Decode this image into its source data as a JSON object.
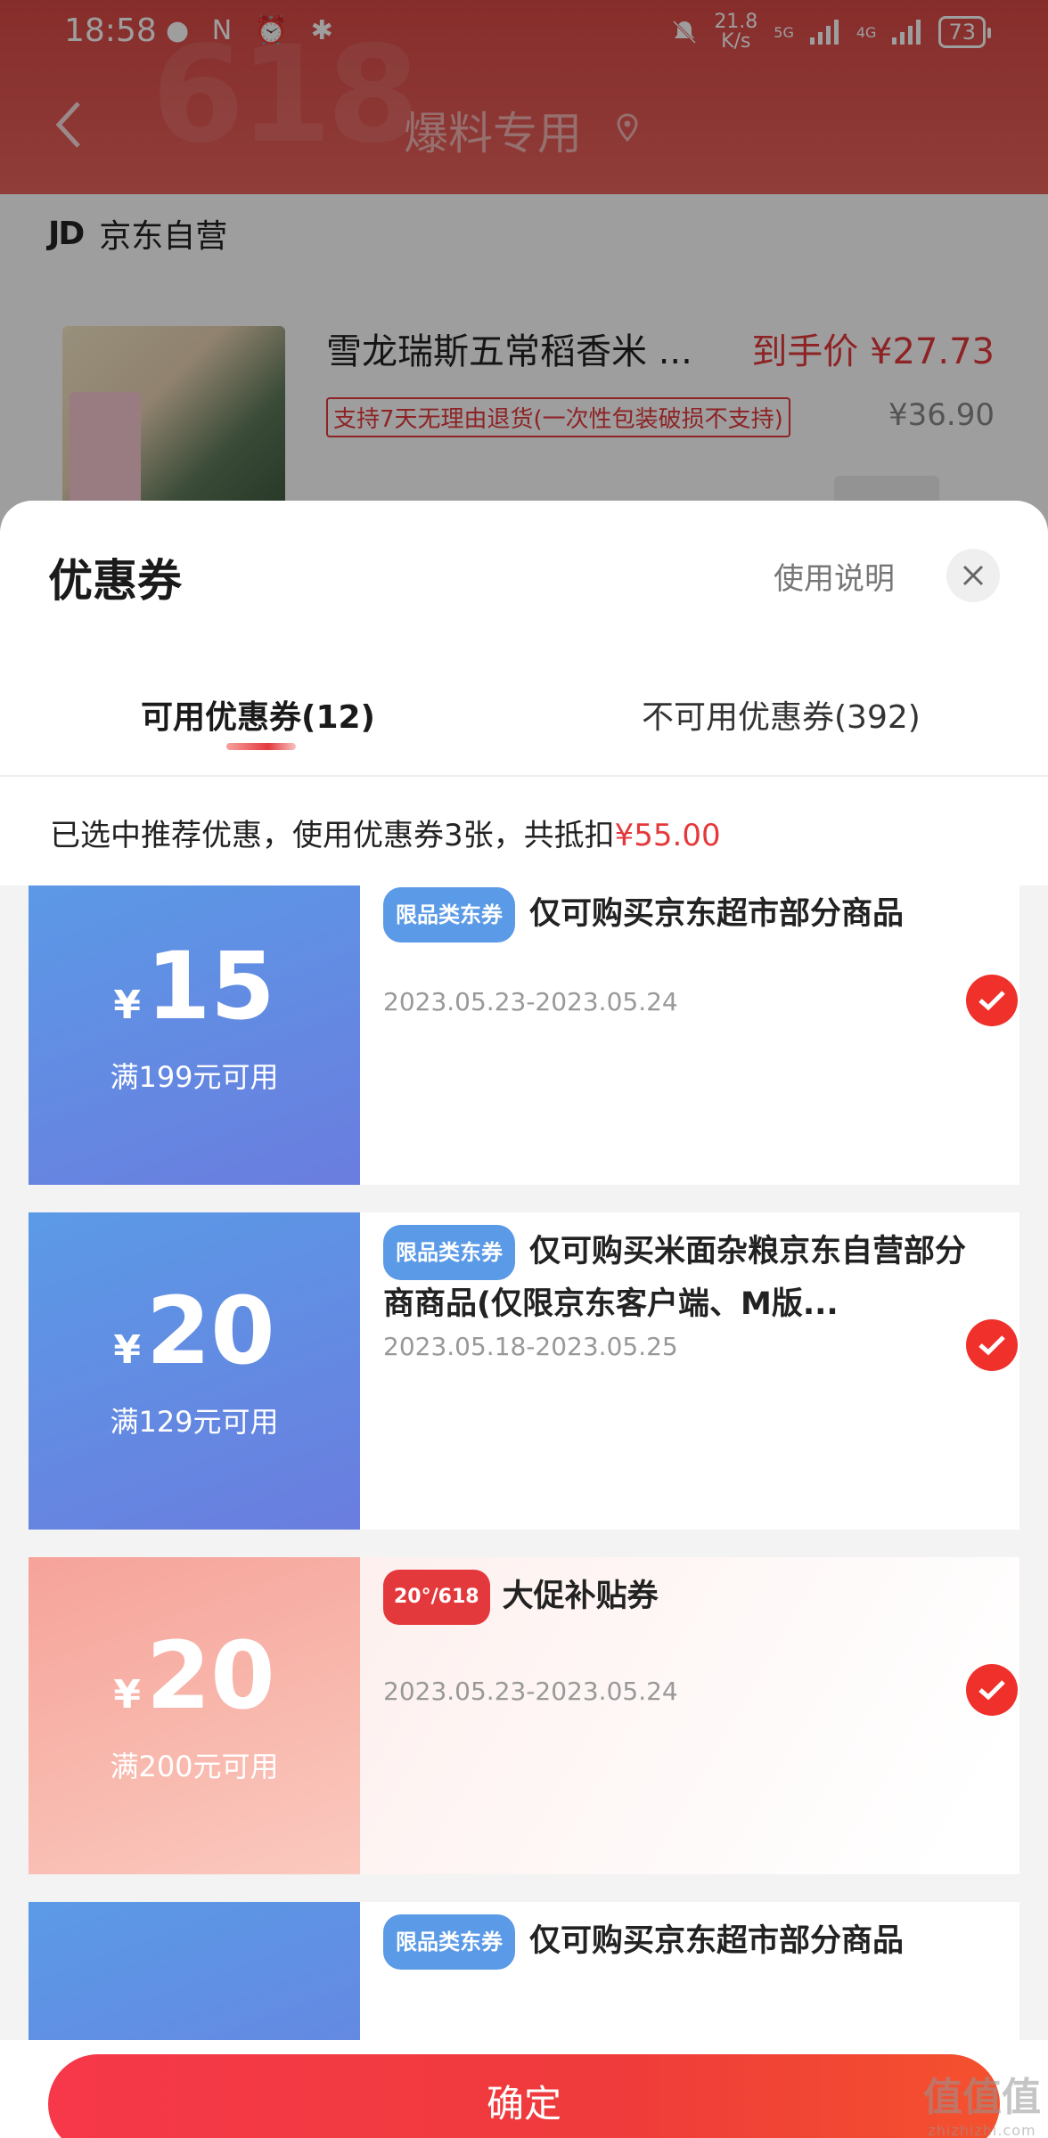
{
  "status_bar": {
    "time": "18:58",
    "left_icons": "● N ⏰ ✱",
    "net_speed_value": "21.8",
    "net_speed_unit": "K/s",
    "signal_5g": "5G",
    "signal_4g": "4G",
    "battery": "73"
  },
  "nav": {
    "title": "爆料专用"
  },
  "store": {
    "logo": "JD",
    "name": "京东自营"
  },
  "product": {
    "name": "雪龙瑞斯五常稻香米 ...",
    "final_price": "到手价 ¥27.73",
    "return_policy": "支持7天无理由退货(一次性包装破损不支持)",
    "original_price": "¥36.90"
  },
  "sheet": {
    "title": "优惠券",
    "help_label": "使用说明",
    "tabs": [
      {
        "label": "可用优惠券(12)",
        "active": true
      },
      {
        "label": "不可用优惠券(392)",
        "active": false
      }
    ],
    "summary_prefix": "已选中推荐优惠，使用优惠券3张，共抵扣",
    "summary_amount": "¥55.00"
  },
  "coupons": [
    {
      "currency": "¥",
      "amount": "15",
      "threshold": "满199元可用",
      "tag": "限品类东券",
      "description": "仅可购买京东超市部分商品",
      "date_range": "2023.05.23-2023.05.24",
      "style": "blue",
      "checked": true
    },
    {
      "currency": "¥",
      "amount": "20",
      "threshold": "满129元可用",
      "tag": "限品类东券",
      "description": "仅可购买米面杂粮京东自营部分商商品(仅限京东客户端、M版...",
      "date_range": "2023.05.18-2023.05.25",
      "style": "blue",
      "checked": true
    },
    {
      "currency": "¥",
      "amount": "20",
      "threshold": "满200元可用",
      "tag": "20°/618",
      "description": "大促补贴券",
      "date_range": "2023.05.23-2023.05.24",
      "style": "pink",
      "checked": true
    },
    {
      "currency": "¥",
      "amount": "",
      "threshold": "",
      "tag": "限品类东券",
      "description": "仅可购买京东超市部分商品",
      "date_range": "",
      "style": "blue",
      "checked": false
    }
  ],
  "confirm_label": "确定",
  "watermark": {
    "text": "值值值",
    "sub": "zhizhizhi.com"
  },
  "colors": {
    "accent_red": "#e4393c",
    "coupon_blue": "#5b9ae6",
    "coupon_pink": "#f6a39a"
  }
}
